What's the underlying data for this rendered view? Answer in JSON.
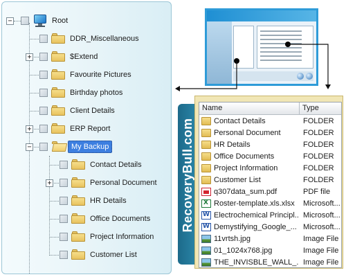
{
  "tree": {
    "root_label": "Root",
    "nodes": [
      {
        "label": "DDR_Miscellaneous",
        "expander": ""
      },
      {
        "label": "$Extend",
        "expander": "+"
      },
      {
        "label": "Favourite Pictures",
        "expander": ""
      },
      {
        "label": "Birthday photos",
        "expander": ""
      },
      {
        "label": "Client Details",
        "expander": ""
      },
      {
        "label": "ERP Report",
        "expander": "+"
      },
      {
        "label": "My Backup",
        "expander": "−",
        "selected": true
      },
      {
        "label": "Contact Details",
        "expander": ""
      },
      {
        "label": "Personal Document",
        "expander": "+"
      },
      {
        "label": "HR Details",
        "expander": ""
      },
      {
        "label": "Office Documents",
        "expander": ""
      },
      {
        "label": "Project Information",
        "expander": ""
      },
      {
        "label": "Customer List",
        "expander": ""
      }
    ],
    "root_expander": "−"
  },
  "brand": {
    "text": "RecoveryBull.com",
    "color": "#2b86a8"
  },
  "file_list": {
    "columns": [
      "Name",
      "Type"
    ],
    "rows": [
      {
        "name": "Contact Details",
        "type": "FOLDER",
        "icon": "folder-icon"
      },
      {
        "name": "Personal Document",
        "type": "FOLDER",
        "icon": "folder-icon"
      },
      {
        "name": "HR Details",
        "type": "FOLDER",
        "icon": "folder-icon"
      },
      {
        "name": "Office Documents",
        "type": "FOLDER",
        "icon": "folder-icon"
      },
      {
        "name": "Project Information",
        "type": "FOLDER",
        "icon": "folder-icon"
      },
      {
        "name": "Customer List",
        "type": "FOLDER",
        "icon": "folder-icon"
      },
      {
        "name": "q307data_sum.pdf",
        "type": "PDF file",
        "icon": "pdf-file-icon"
      },
      {
        "name": "Roster-template.xls.xlsx",
        "type": "Microsoft...",
        "icon": "excel-file-icon"
      },
      {
        "name": "Electrochemical Principl...",
        "type": "Microsoft...",
        "icon": "word-file-icon"
      },
      {
        "name": "Demystifying_Google_...",
        "type": "Microsoft...",
        "icon": "word-file-icon"
      },
      {
        "name": "11vrtsh.jpg",
        "type": "Image File",
        "icon": "image-file-icon"
      },
      {
        "name": "01_1024x768.jpg",
        "type": "Image File",
        "icon": "image-file-icon"
      },
      {
        "name": "THE_INVISBLE_WALL_...",
        "type": "Image File",
        "icon": "image-file-icon"
      }
    ]
  },
  "colors": {
    "selection": "#3d7fe0",
    "panel_border": "#9bc6d6",
    "file_panel_bg": "#f1e6b5",
    "thumb_border": "#2e9bd8"
  }
}
